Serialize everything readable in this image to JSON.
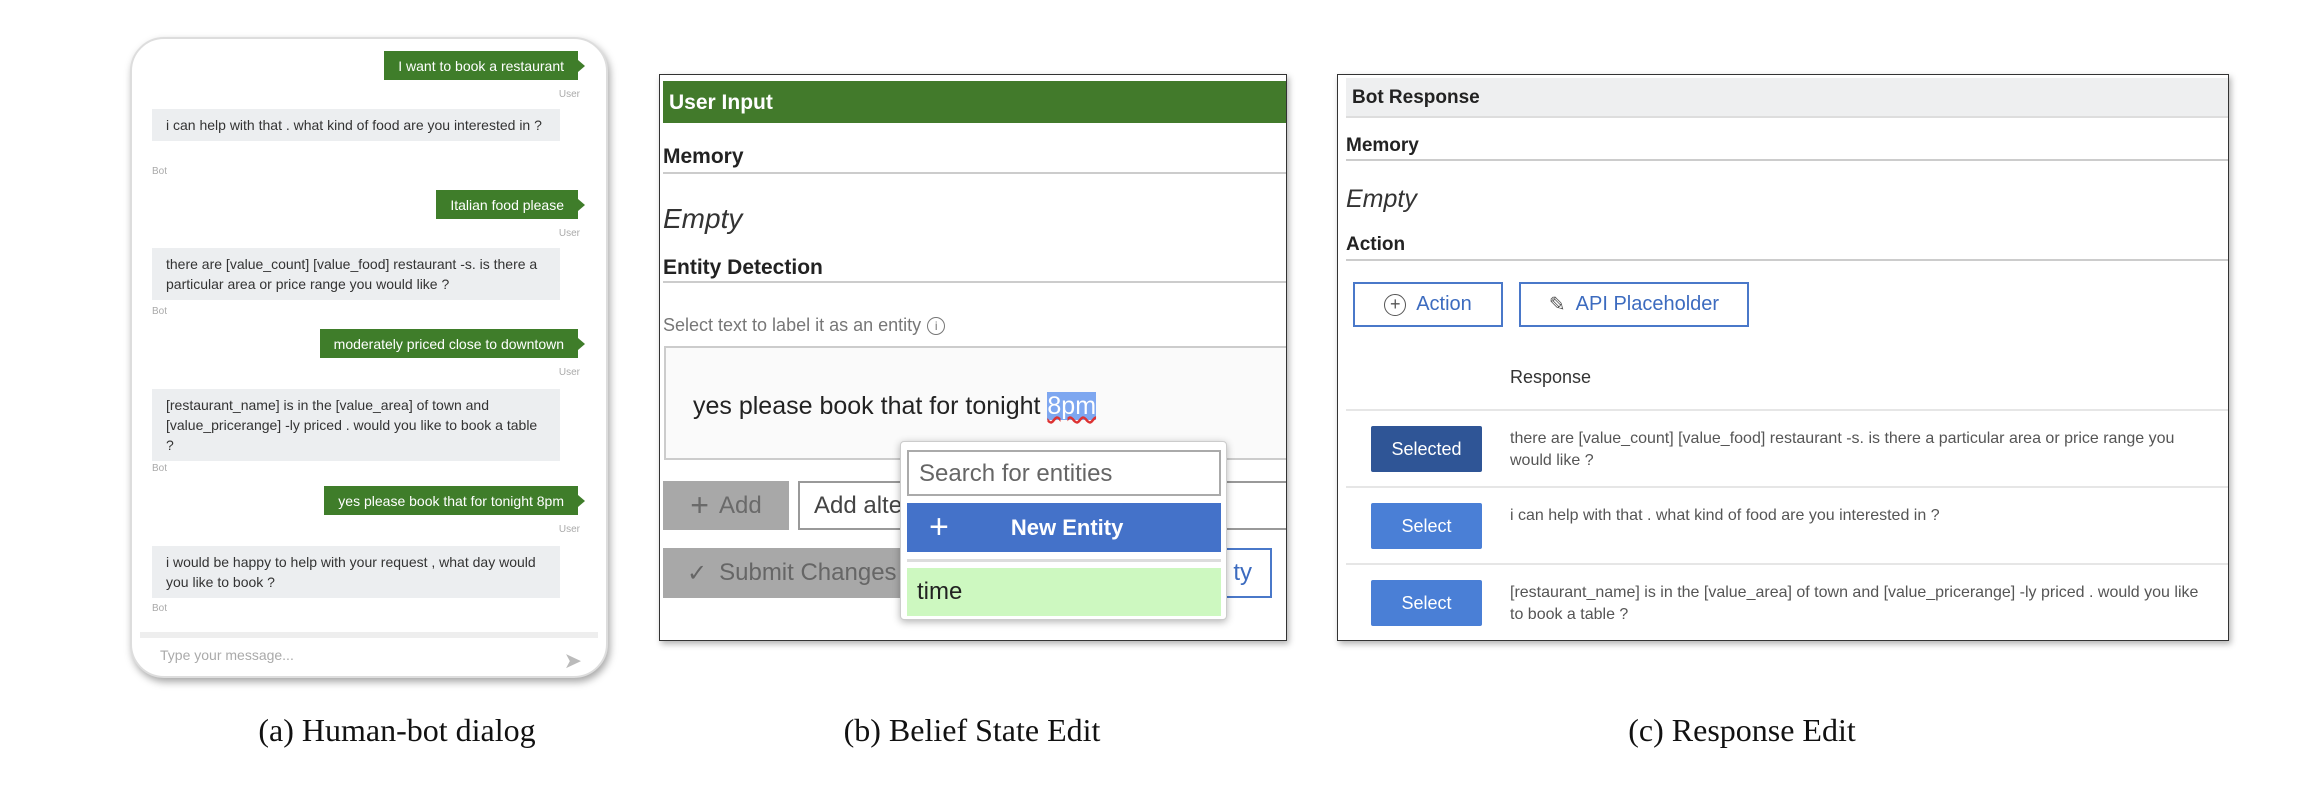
{
  "captions": {
    "a": "(a) Human-bot dialog",
    "b": "(b) Belief State Edit",
    "c": "(c) Response Edit"
  },
  "colors": {
    "user_bubble": "#3f7d2a",
    "bot_bubble": "#eceef0",
    "primary": "#4a7fd6",
    "selected": "#2f5596",
    "entity_match": "#cdf8c0"
  },
  "chat": {
    "messages": [
      {
        "role": "user",
        "text": "I want to book a restaurant",
        "label": "User"
      },
      {
        "role": "bot",
        "text": "i can help with that . what kind of food are you interested in ?",
        "label": "Bot"
      },
      {
        "role": "user",
        "text": "Italian food please",
        "label": "User"
      },
      {
        "role": "bot",
        "text": "there are [value_count] [value_food] restaurant -s. is there a particular area or price range you would like ?",
        "label": "Bot"
      },
      {
        "role": "user",
        "text": "moderately priced close to downtown",
        "label": "User"
      },
      {
        "role": "bot",
        "text": "[restaurant_name] is in the [value_area] of town and [value_pricerange] -ly priced . would you like to book a table ?",
        "label": "Bot"
      },
      {
        "role": "user",
        "text": "yes please book that for tonight 8pm",
        "label": "User"
      },
      {
        "role": "bot",
        "text": "i would be happy to help with your request , what day would you like to book ?",
        "label": "Bot"
      }
    ],
    "input_placeholder": "Type your message...",
    "send_icon": "send-icon"
  },
  "belief": {
    "header": "User Input",
    "memory_label": "Memory",
    "memory_value": "Empty",
    "entity_label": "Entity Detection",
    "hint": "Select text to label it as an entity",
    "utterance_prefix": "yes please book that for tonight ",
    "utterance_selected": "8pm",
    "add_label": "Add",
    "alt_placeholder": "Add alter",
    "submit_label": "Submit Changes",
    "hidden_button_fragment": "ty",
    "popup": {
      "search_placeholder": "Search for entities",
      "new_entity_label": "New Entity",
      "options": [
        "time"
      ]
    }
  },
  "response": {
    "header": "Bot Response",
    "memory_label": "Memory",
    "memory_value": "Empty",
    "action_label": "Action",
    "action_button": "Action",
    "api_button": "API Placeholder",
    "column_header": "Response",
    "rows": [
      {
        "button": "Selected",
        "selected": true,
        "text": "there are [value_count] [value_food] restaurant -s. is there a particular area or price range you would like ?"
      },
      {
        "button": "Select",
        "selected": false,
        "text": "i can help with that . what kind of food are you interested in ?"
      },
      {
        "button": "Select",
        "selected": false,
        "text": "[restaurant_name] is in the [value_area] of town and [value_pricerange] -ly priced . would you like to book a table ?"
      }
    ]
  }
}
